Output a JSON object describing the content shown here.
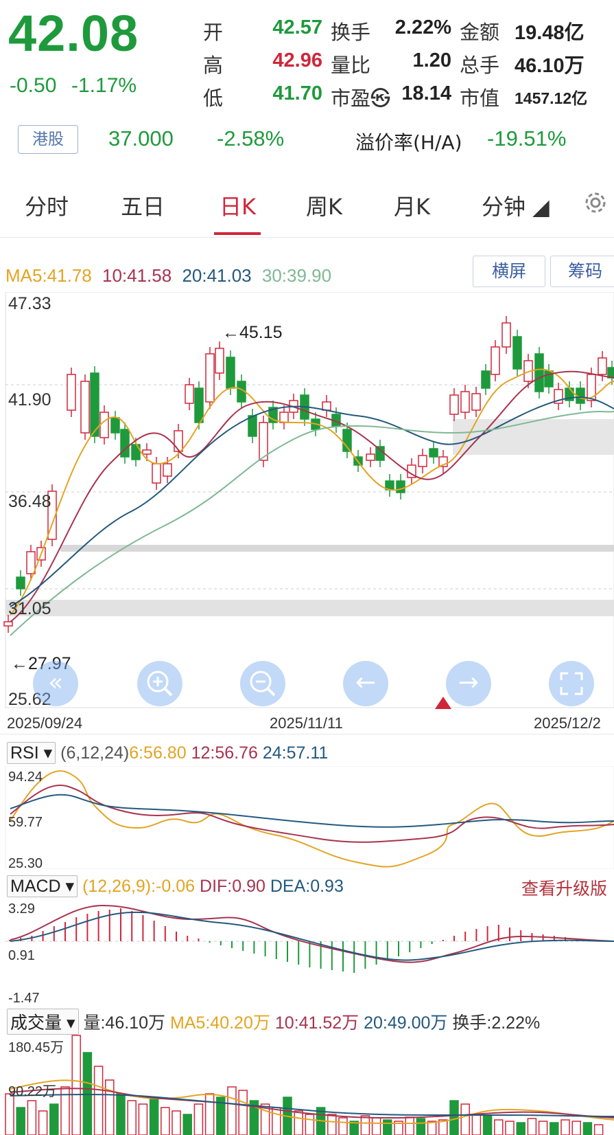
{
  "quote": {
    "price": "42.08",
    "change": "-0.50",
    "change_pct": "-1.17%",
    "rows": [
      {
        "l1": "开",
        "v1": "42.57",
        "c1": "green",
        "l2": "换手",
        "v2": "2.22%",
        "c2": "dark",
        "l3": "金额",
        "v3": "19.48亿"
      },
      {
        "l1": "高",
        "v1": "42.96",
        "c1": "red",
        "l2": "量比",
        "v2": "1.20",
        "c2": "dark",
        "l3": "总手",
        "v3": "46.10万"
      },
      {
        "l1": "低",
        "v1": "41.70",
        "c1": "green",
        "l2": "市盈㉿",
        "v2": "18.14",
        "c2": "dark",
        "l3": "市值",
        "v3": "1457.12亿"
      }
    ],
    "hk": {
      "badge": "港股",
      "price": "37.000",
      "change_pct": "-2.58%",
      "premium_label": "溢价率(H/A)",
      "premium": "-19.51%"
    }
  },
  "tabs": [
    "分时",
    "五日",
    "日K",
    "周K",
    "月K",
    "分钟 ◢"
  ],
  "active_tab": 2,
  "main_chart": {
    "ma_labels": {
      "ma5": "MA5:41.78",
      "ma10": "10:41.58",
      "ma20": "20:41.03",
      "ma30": "30:39.90"
    },
    "buttons": {
      "landscape": "横屏",
      "chips": "筹码"
    },
    "y_ticks": [
      "47.33",
      "41.90",
      "36.48",
      "31.05",
      "25.62"
    ],
    "high_note": "←45.15",
    "low_note": "←27.97",
    "dates": [
      "2025/09/24",
      "2025/11/11",
      "2025/12/2"
    ],
    "colors": {
      "up": "#d0263a",
      "down": "#1e9a3c",
      "ma5": "#e3a423",
      "ma10": "#a8334f",
      "ma20": "#23597d",
      "ma30": "#7fb894"
    }
  },
  "rsi": {
    "selector": "RSI",
    "params": "(6,12,24)",
    "v6": "6:56.80",
    "v12": "12:56.76",
    "v24": "24:57.11",
    "y_ticks": [
      "94.24",
      "59.77",
      "25.30"
    ]
  },
  "macd": {
    "selector": "MACD",
    "params": "(12,26,9):-0.06",
    "dif": "DIF:0.90",
    "dea": "DEA:0.93",
    "upgrade": "查看升级版",
    "y_ticks": [
      "3.29",
      "0.91",
      "-1.47"
    ]
  },
  "volume": {
    "selector": "成交量",
    "vol": "量:46.10万",
    "ma5": "MA5:40.20万",
    "ma10": "10:41.52万",
    "ma20": "20:49.00万",
    "turnover": "换手:2.22%",
    "y_ticks": [
      "180.45万",
      "90.22万"
    ]
  }
}
